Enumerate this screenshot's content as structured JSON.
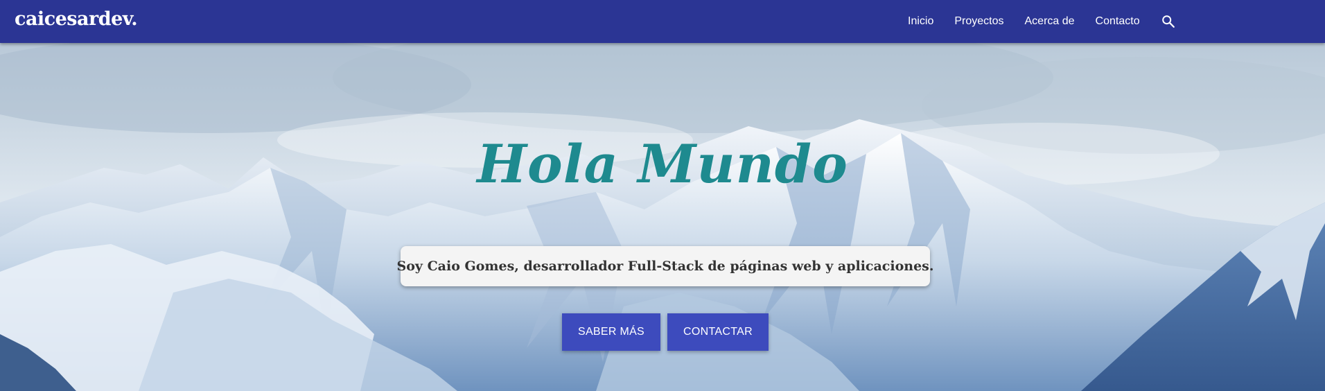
{
  "navbar": {
    "brand": "caicesardev.",
    "links": [
      "Inicio",
      "Proyectos",
      "Acerca de",
      "Contacto"
    ],
    "search_icon": "search-icon",
    "background": "#2b3594"
  },
  "hero": {
    "title": "Hola Mundo",
    "tagline": "Soy Caio Gomes, desarrollador Full-Stack de páginas web y aplicaciones.",
    "buttons": {
      "more": "SABER MÁS",
      "contact": "CONTACTAR"
    },
    "title_color": "#1e8a8f",
    "button_color": "#3d4bbd"
  }
}
